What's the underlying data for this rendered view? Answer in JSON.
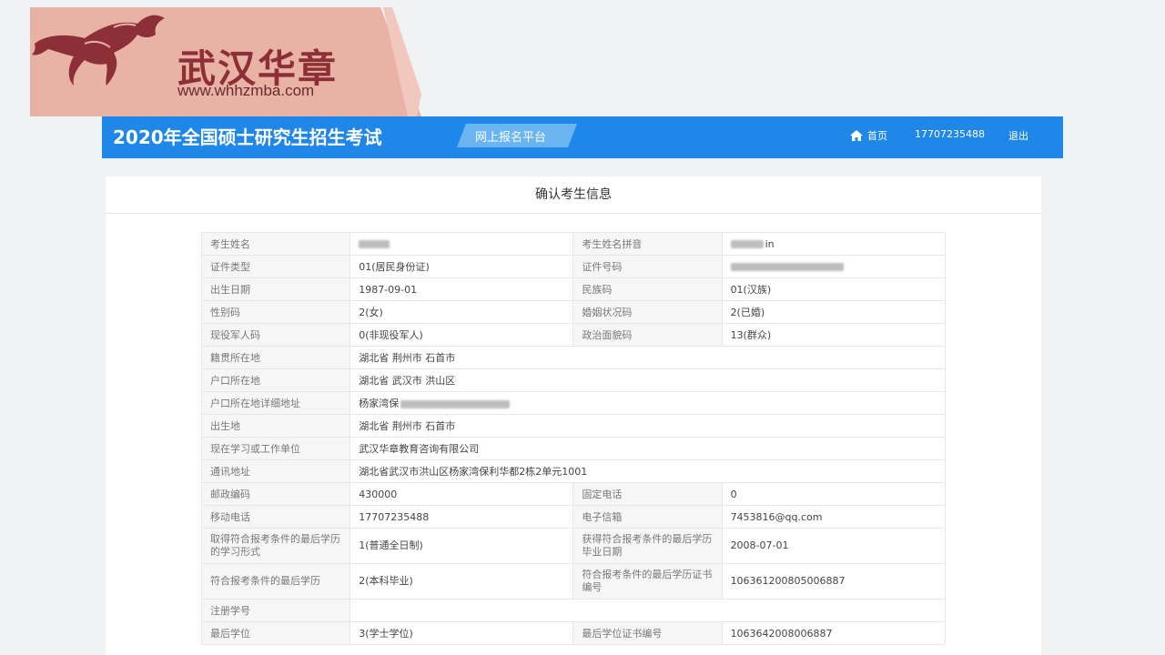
{
  "watermark": {
    "name": "武汉华章",
    "url": "www.whhzmba.com",
    "bg_color": "#e8b3a5"
  },
  "header": {
    "title": "2020年全国硕士研究生招生考试",
    "platform": "网上报名平台",
    "nav": {
      "home": "首页",
      "phone": "17707235488",
      "logout": "退出"
    },
    "bar_color": "#1f87e8"
  },
  "panel": {
    "title": "确认考生信息"
  },
  "rows": [
    {
      "l1": "考生姓名",
      "v1": "",
      "l2": "考生姓名拼音",
      "v2": "in"
    },
    {
      "l1": "证件类型",
      "v1": "01(居民身份证)",
      "l2": "证件号码",
      "v2": ""
    },
    {
      "l1": "出生日期",
      "v1": "1987-09-01",
      "l2": "民族码",
      "v2": "01(汉族)"
    },
    {
      "l1": "性别码",
      "v1": "2(女)",
      "l2": "婚姻状况码",
      "v2": "2(已婚)"
    },
    {
      "l1": "现役军人码",
      "v1": "0(非现役军人)",
      "l2": "政治面貌码",
      "v2": "13(群众)"
    },
    {
      "l1": "籍贯所在地",
      "v1": "湖北省 荆州市 石首市"
    },
    {
      "l1": "户口所在地",
      "v1": "湖北省 武汉市 洪山区"
    },
    {
      "l1": "户口所在地详细地址",
      "v1": "杨家湾保"
    },
    {
      "l1": "出生地",
      "v1": "湖北省 荆州市 石首市"
    },
    {
      "l1": "现在学习或工作单位",
      "v1": "武汉华章教育咨询有限公司"
    },
    {
      "l1": "通讯地址",
      "v1": "湖北省武汉市洪山区杨家湾保利华都2栋2单元1001"
    },
    {
      "l1": "邮政编码",
      "v1": "430000",
      "l2": "固定电话",
      "v2": "0"
    },
    {
      "l1": "移动电话",
      "v1": "17707235488",
      "l2": "电子信箱",
      "v2": "7453816@qq.com"
    },
    {
      "l1": "取得符合报考条件的最后学历的学习形式",
      "v1": "1(普通全日制)",
      "l2": "获得符合报考条件的最后学历毕业日期",
      "v2": "2008-07-01"
    },
    {
      "l1": "符合报考条件的最后学历",
      "v1": "2(本科毕业)",
      "l2": "符合报考条件的最后学历证书编号",
      "v2": "106361200805006887"
    },
    {
      "l1": "注册学号",
      "v1": ""
    },
    {
      "l1": "最后学位",
      "v1": "3(学士学位)",
      "l2": "最后学位证书编号",
      "v2": "1063642008006887"
    }
  ]
}
